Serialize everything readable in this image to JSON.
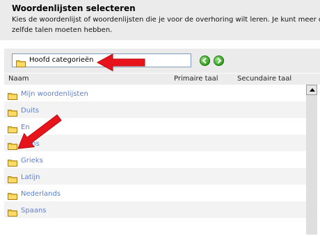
{
  "header": {
    "title": "Woordenlijsten selecteren",
    "line1": "Kies de woordenlijst of woordenlijsten die je voor de overhoring wilt leren. Je kunt meer dan",
    "line2": "zelfde talen moeten hebben."
  },
  "toolbar": {
    "category_label": "Hoofd categorieën",
    "prev_icon": "arrow-left-circle",
    "next_icon": "arrow-right-circle"
  },
  "columns": {
    "name": "Naam",
    "primary": "Primaire taal",
    "secondary": "Secundaire taal"
  },
  "rows": [
    {
      "label": "Mijn woordenlijsten"
    },
    {
      "label": "Duits"
    },
    {
      "label": "En"
    },
    {
      "label": "Frans"
    },
    {
      "label": "Grieks"
    },
    {
      "label": "Latijn"
    },
    {
      "label": "Nederlands"
    },
    {
      "label": "Spaans"
    }
  ],
  "colors": {
    "link": "#5b7fd2",
    "annotation_arrow": "#e8141b",
    "folder": "#f1c232"
  }
}
